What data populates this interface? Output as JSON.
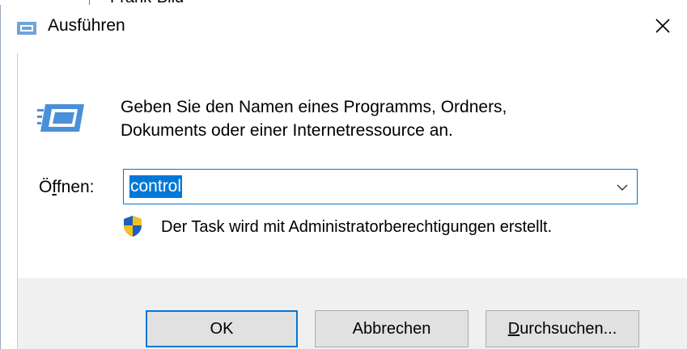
{
  "window": {
    "title": "Ausführen",
    "title_icon": "run-dialog-icon",
    "close_icon": "close-icon"
  },
  "background": {
    "partial_text": "Frank-Bild"
  },
  "dialog": {
    "icon": "run-program-icon",
    "description_line1": "Geben Sie den Namen eines Programms, Ordners,",
    "description_line2": "Dokuments oder einer Internetressource an.",
    "open_label_prefix": "Ö",
    "open_label_accel": "f",
    "open_label_suffix": "fnen:",
    "open_value": "control",
    "dropdown_icon": "chevron-down-icon",
    "admin_icon": "uac-shield-icon",
    "admin_note": "Der Task wird mit Administratorberechtigungen erstellt."
  },
  "buttons": {
    "ok": "OK",
    "cancel": "Abbrechen",
    "browse_accel": "D",
    "browse_rest": "urchsuchen..."
  },
  "colors": {
    "accent": "#0078d7",
    "footer_bg": "#f0f0f0",
    "button_bg": "#e1e1e1"
  }
}
